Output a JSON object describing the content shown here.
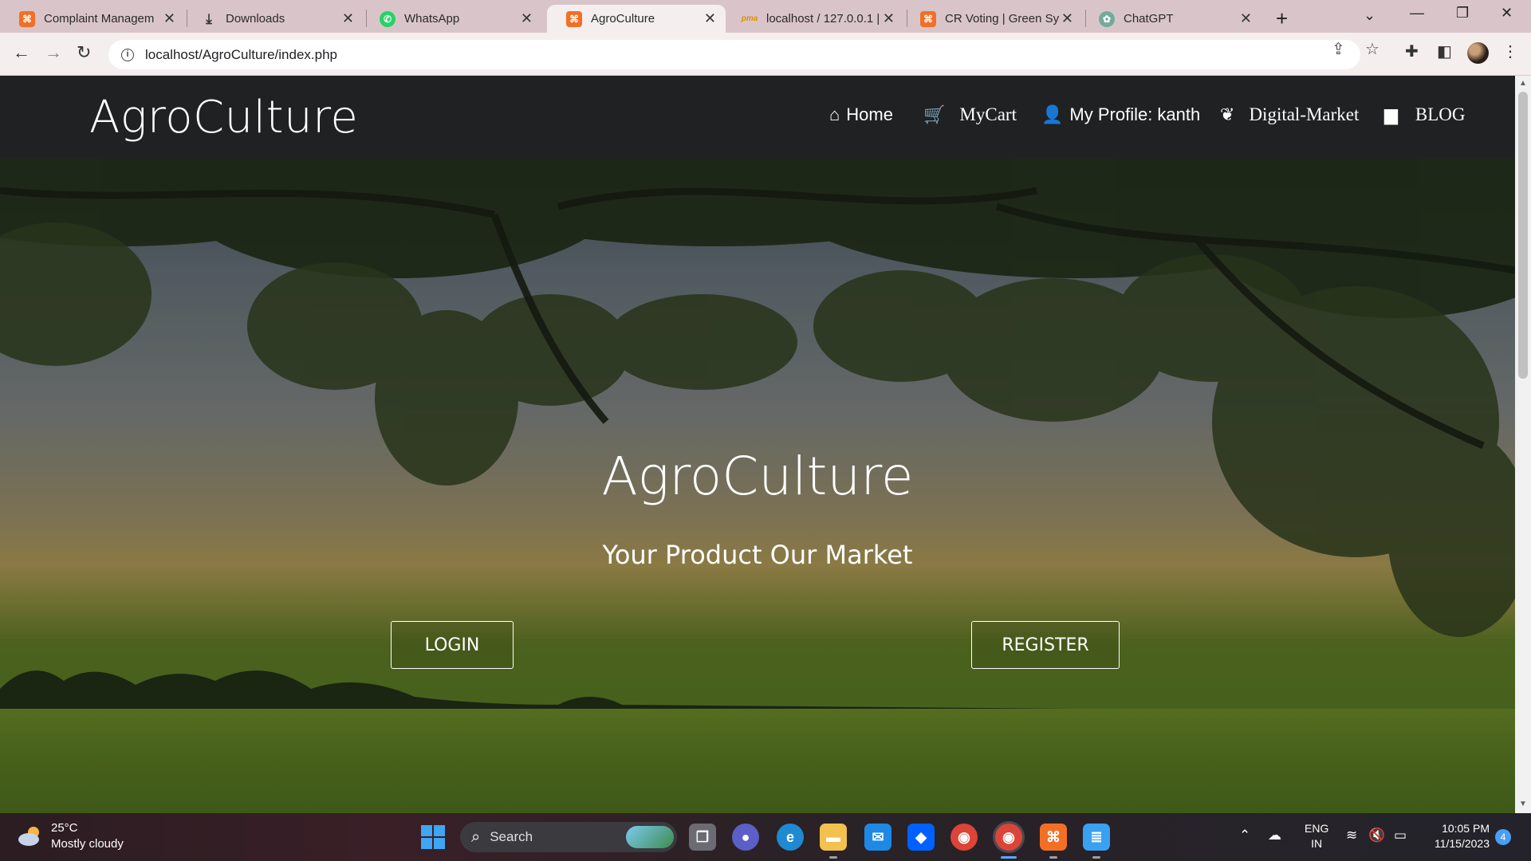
{
  "browser": {
    "tabs": [
      {
        "title": "Complaint Managem",
        "icon": "xampp-icon"
      },
      {
        "title": "Downloads",
        "icon": "download-icon"
      },
      {
        "title": "WhatsApp",
        "icon": "whatsapp-icon"
      },
      {
        "title": "AgroCulture",
        "icon": "xampp-icon",
        "active": true
      },
      {
        "title": "localhost / 127.0.0.1 |",
        "icon": "phpmyadmin-icon"
      },
      {
        "title": "CR Voting | Green Sy",
        "icon": "xampp-icon"
      },
      {
        "title": "ChatGPT",
        "icon": "chatgpt-icon"
      }
    ],
    "tab_close_glyph": "✕",
    "new_tab_glyph": "+",
    "url": "localhost/AgroCulture/index.php"
  },
  "site": {
    "brand": "AgroCulture",
    "nav": {
      "home": "Home",
      "cart": "MyCart",
      "profile": "My Profile: kanth",
      "market": "Digital-Market",
      "blog": "BLOG"
    }
  },
  "hero": {
    "title": "AgroCulture",
    "subtitle": "Your Product Our Market",
    "login": "LOGIN",
    "register": "REGISTER"
  },
  "taskbar": {
    "weather_temp": "25°C",
    "weather_desc": "Mostly cloudy",
    "search_label": "Search",
    "lang_top": "ENG",
    "lang_bottom": "IN",
    "time": "10:05 PM",
    "date": "11/15/2023",
    "notification_count": "4"
  },
  "colors": {
    "tab_strip": "#d9c5c9",
    "site_nav": "#1f2122",
    "accent_blue": "#3fa6f2"
  }
}
